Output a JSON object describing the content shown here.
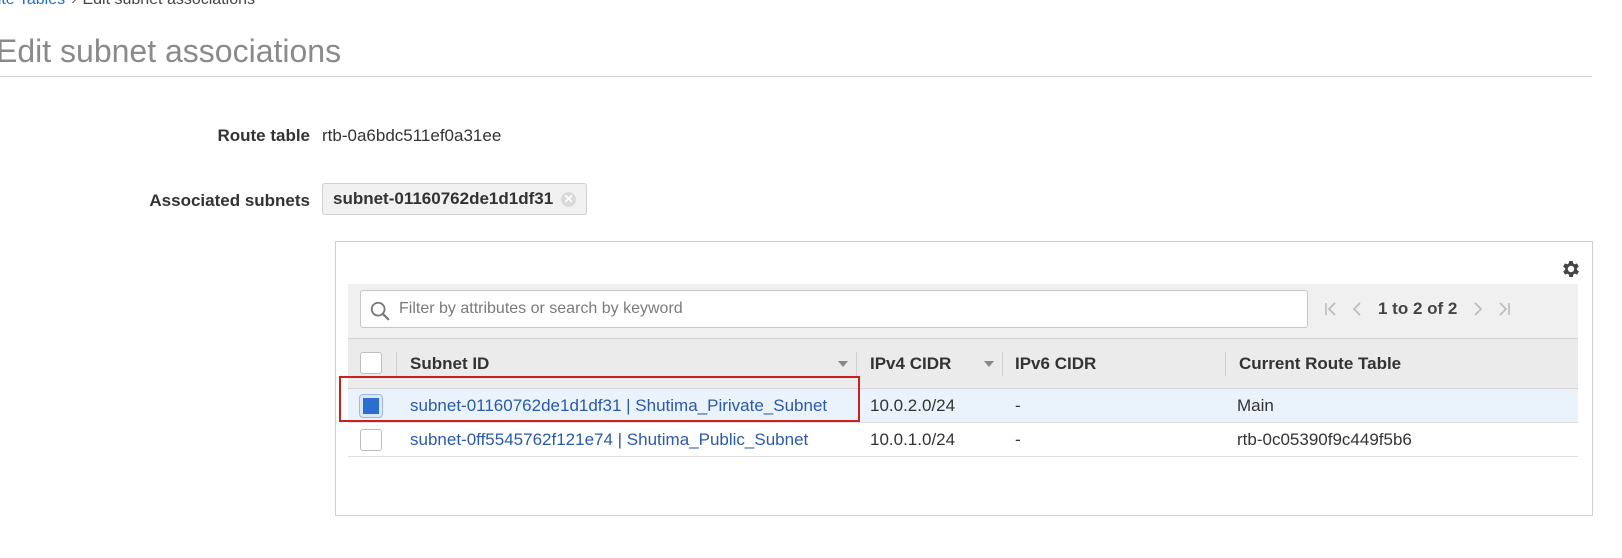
{
  "breadcrumb": {
    "parent": "Route Tables",
    "separator": "›",
    "current": "Edit subnet associations"
  },
  "page_title": "Edit subnet associations",
  "form": {
    "route_table_label": "Route table",
    "route_table_value": "rtb-0a6bdc511ef0a31ee",
    "associated_subnets_label": "Associated subnets",
    "associated_subnet_token": "subnet-01160762de1d1df31",
    "token_remove_glyph": "✕"
  },
  "table": {
    "search_placeholder": "Filter by attributes or search by keyword",
    "search_value": "",
    "pagination": "1 to 2 of 2",
    "columns": [
      "Subnet ID",
      "IPv4 CIDR",
      "IPv6 CIDR",
      "Current Route Table"
    ],
    "rows": [
      {
        "subnet": "subnet-01160762de1d1df31 | Shutima_Pirivate_Subnet",
        "ipv4": "10.0.2.0/24",
        "ipv6": "-",
        "route_table": "Main",
        "checked": true
      },
      {
        "subnet": "subnet-0ff5545762f121e74 | Shutima_Public_Subnet",
        "ipv4": "10.0.1.0/24",
        "ipv6": "-",
        "route_table": "rtb-0c05390f9c449f5b6",
        "checked": false
      }
    ]
  },
  "icons": {
    "settings": "gear-icon",
    "search": "search-icon",
    "first": "first-page-icon",
    "prev": "prev-page-icon",
    "next": "next-page-icon",
    "last": "last-page-icon",
    "remove": "remove-token-icon"
  },
  "colors": {
    "link": "#2a5aa8",
    "checkbox_checked": "#2b6ed2",
    "selected_row": "#eaf2fb",
    "highlight_box": "#cc2020"
  }
}
